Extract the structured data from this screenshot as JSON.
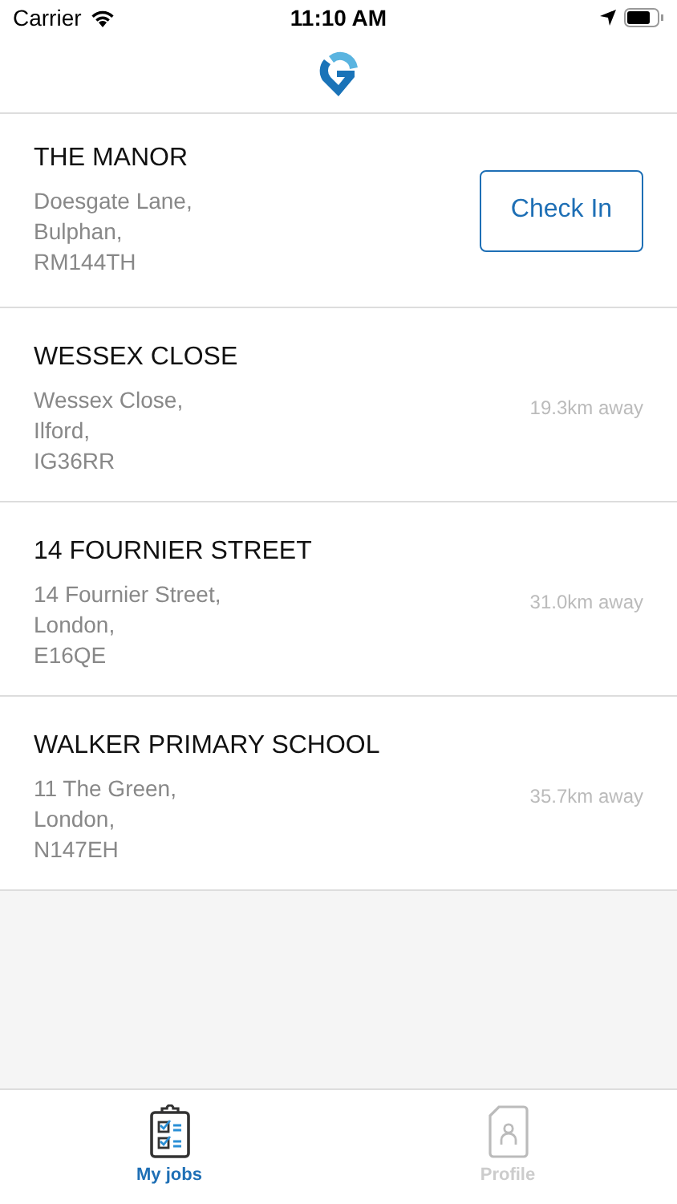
{
  "status_bar": {
    "carrier": "Carrier",
    "time": "11:10 AM"
  },
  "jobs": [
    {
      "name": "THE MANOR",
      "address": [
        "Doesgate Lane,",
        "Bulphan,",
        "RM144TH"
      ],
      "kind": "checkin",
      "action": "Check In"
    },
    {
      "name": "WESSEX CLOSE",
      "address": [
        "Wessex Close,",
        "Ilford,",
        "IG36RR"
      ],
      "kind": "distance",
      "action": "19.3km away"
    },
    {
      "name": "14 FOURNIER STREET",
      "address": [
        "14 Fournier Street,",
        "London,",
        "E16QE"
      ],
      "kind": "distance",
      "action": "31.0km away"
    },
    {
      "name": "WALKER PRIMARY SCHOOL",
      "address": [
        "11 The Green,",
        "London,",
        "N147EH"
      ],
      "kind": "distance",
      "action": "35.7km away"
    }
  ],
  "tabs": [
    {
      "label": "My jobs",
      "selected": true,
      "kind": "jobs"
    },
    {
      "label": "Profile",
      "selected": false,
      "kind": "profile"
    }
  ]
}
